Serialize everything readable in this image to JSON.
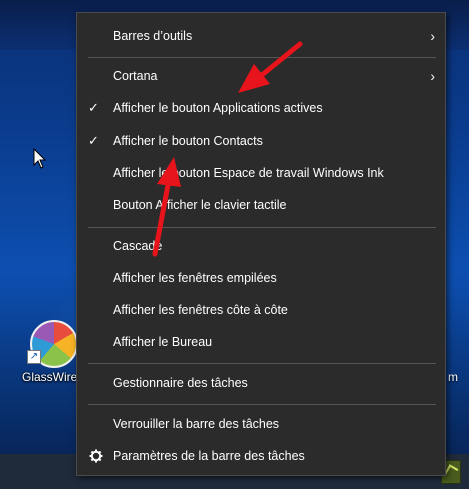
{
  "desktop": {
    "icon_label": "GlassWire",
    "right_edge_letter": "m"
  },
  "menu": {
    "items": [
      {
        "label": "Barres d’outils",
        "checked": false,
        "submenu": true
      },
      {
        "label": "Cortana",
        "checked": false,
        "submenu": true
      },
      {
        "label": "Afficher le bouton Applications actives",
        "checked": true,
        "submenu": false
      },
      {
        "label": "Afficher le bouton Contacts",
        "checked": true,
        "submenu": false
      },
      {
        "label": "Afficher le bouton Espace de travail Windows Ink",
        "checked": false,
        "submenu": false
      },
      {
        "label": "Bouton Afficher le clavier tactile",
        "checked": false,
        "submenu": false
      },
      {
        "label": "Cascade",
        "checked": false,
        "submenu": false
      },
      {
        "label": "Afficher les fenêtres empilées",
        "checked": false,
        "submenu": false
      },
      {
        "label": "Afficher les fenêtres côte à côte",
        "checked": false,
        "submenu": false
      },
      {
        "label": "Afficher le Bureau",
        "checked": false,
        "submenu": false
      },
      {
        "label": "Gestionnaire des tâches",
        "checked": false,
        "submenu": false
      },
      {
        "label": "Verrouiller la barre des tâches",
        "checked": false,
        "submenu": false
      },
      {
        "label": "Paramètres de la barre des tâches",
        "checked": false,
        "submenu": false,
        "icon": "gear-icon"
      }
    ],
    "check_glyph": "✓",
    "chevron_glyph": "›"
  },
  "colors": {
    "menu_background": "#2b2b2b",
    "menu_text": "#ffffff",
    "separator": "#555555",
    "annotation_arrow": "#e8141b"
  }
}
